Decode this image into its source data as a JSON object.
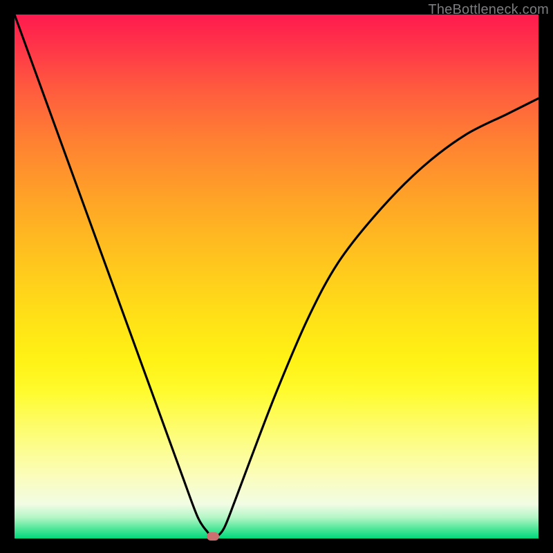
{
  "watermark": "TheBottleneck.com",
  "colors": {
    "page_bg": "#000000",
    "gradient_top": "#ff1a4e",
    "gradient_bottom": "#00d87b",
    "curve": "#000000",
    "marker": "#cc6f70"
  },
  "chart_data": {
    "type": "line",
    "title": "",
    "xlabel": "",
    "ylabel": "",
    "xlim": [
      0,
      100
    ],
    "ylim": [
      0,
      100
    ],
    "grid": false,
    "legend": false,
    "annotations": [],
    "series": [
      {
        "name": "curve",
        "x": [
          0,
          4,
          8,
          12,
          16,
          20,
          24,
          28,
          32,
          35,
          37,
          37.5,
          38.5,
          40,
          42,
          45,
          50,
          56,
          62,
          70,
          78,
          86,
          94,
          100
        ],
        "y": [
          100,
          89,
          78,
          67,
          56,
          45,
          34,
          23,
          12,
          4,
          1,
          0,
          0.3,
          2,
          7,
          15,
          28,
          42,
          53,
          63,
          71,
          77,
          81,
          84
        ]
      }
    ],
    "marker": {
      "x": 37.9,
      "y": 0
    }
  }
}
